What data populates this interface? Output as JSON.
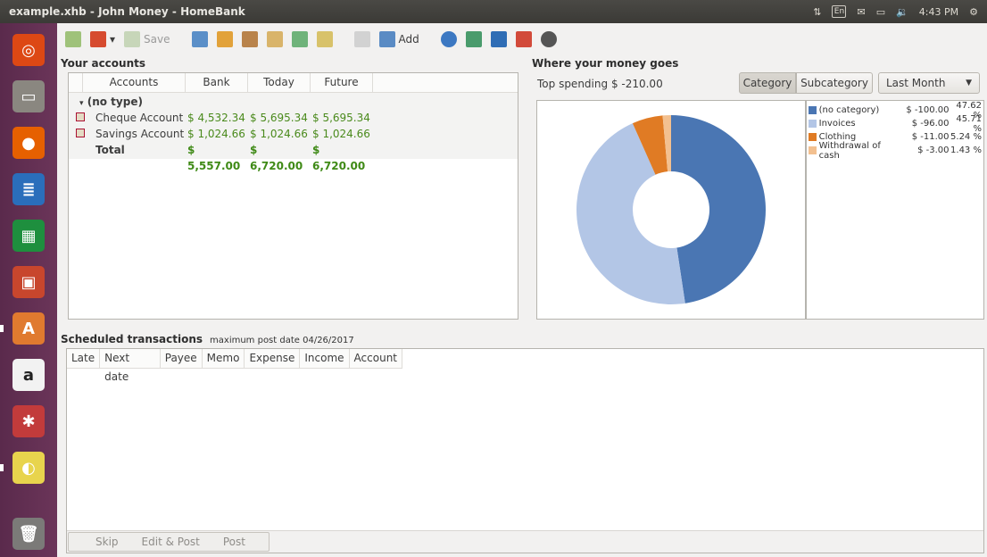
{
  "window": {
    "title": "example.xhb - John Money - HomeBank"
  },
  "indicators": {
    "lang": "En",
    "time": "4:43 PM"
  },
  "launcher": {
    "items": [
      {
        "name": "ubuntu-dash-icon",
        "color": "#dd4814",
        "glyph": "◎"
      },
      {
        "name": "files-icon",
        "color": "#8a8780",
        "glyph": "▭"
      },
      {
        "name": "firefox-icon",
        "color": "#e66000",
        "glyph": "●"
      },
      {
        "name": "writer-icon",
        "color": "#2a6ebb",
        "glyph": "≣"
      },
      {
        "name": "calc-icon",
        "color": "#1e8f3e",
        "glyph": "▦"
      },
      {
        "name": "impress-icon",
        "color": "#c8462d",
        "glyph": "▣"
      },
      {
        "name": "software-center-icon",
        "color": "#e07a2f",
        "glyph": "A"
      },
      {
        "name": "amazon-icon",
        "color": "#f2f2f2",
        "glyph": "a"
      },
      {
        "name": "settings-icon",
        "color": "#c23b3b",
        "glyph": "✱"
      },
      {
        "name": "homebank-icon",
        "color": "#e8d44d",
        "glyph": "◐"
      },
      {
        "name": "trash-icon",
        "color": "#7b7a78",
        "glyph": "🗑"
      }
    ]
  },
  "toolbar": {
    "save_label": "Save",
    "add_label": "Add"
  },
  "accounts": {
    "section_title": "Your accounts",
    "columns": [
      "Accounts",
      "Bank",
      "Today",
      "Future"
    ],
    "group_label": "(no type)",
    "rows": [
      {
        "name": "Cheque Account",
        "bank": "$ 4,532.34",
        "today": "$ 5,695.34",
        "future": "$ 5,695.34"
      },
      {
        "name": "Savings Account",
        "bank": "$ 1,024.66",
        "today": "$ 1,024.66",
        "future": "$ 1,024.66"
      }
    ],
    "total": {
      "name": "Total",
      "bank": "$ 5,557.00",
      "today": "$ 6,720.00",
      "future": "$ 6,720.00"
    }
  },
  "spending": {
    "section_title": "Where your money goes",
    "top_label": "Top spending",
    "top_value": "$ -210.00",
    "category_tab": "Category",
    "subcategory_tab": "Subcategory",
    "period": "Last Month",
    "legend": [
      {
        "name": "(no category)",
        "amount": "$ -100.00",
        "pct": "47.62 %",
        "color": "#4a76b3"
      },
      {
        "name": "Invoices",
        "amount": "$ -96.00",
        "pct": "45.71 %",
        "color": "#b3c6e6"
      },
      {
        "name": "Clothing",
        "amount": "$ -11.00",
        "pct": "5.24 %",
        "color": "#e07b24"
      },
      {
        "name": "Withdrawal of cash",
        "amount": "$ -3.00",
        "pct": "1.43 %",
        "color": "#f3c08f"
      }
    ],
    "chart_data": {
      "type": "pie",
      "categories": [
        "(no category)",
        "Invoices",
        "Clothing",
        "Withdrawal of cash"
      ],
      "values": [
        100,
        96,
        11,
        3
      ],
      "colors": [
        "#4a76b3",
        "#b3c6e6",
        "#e07b24",
        "#f3c08f"
      ]
    }
  },
  "scheduled": {
    "section_title": "Scheduled transactions",
    "max_post_date": "maximum post date 04/26/2017",
    "columns": [
      "Late",
      "Next date",
      "Payee",
      "Memo",
      "Expense",
      "Income",
      "Account"
    ],
    "actions": [
      "Skip",
      "Edit & Post",
      "Post"
    ]
  }
}
